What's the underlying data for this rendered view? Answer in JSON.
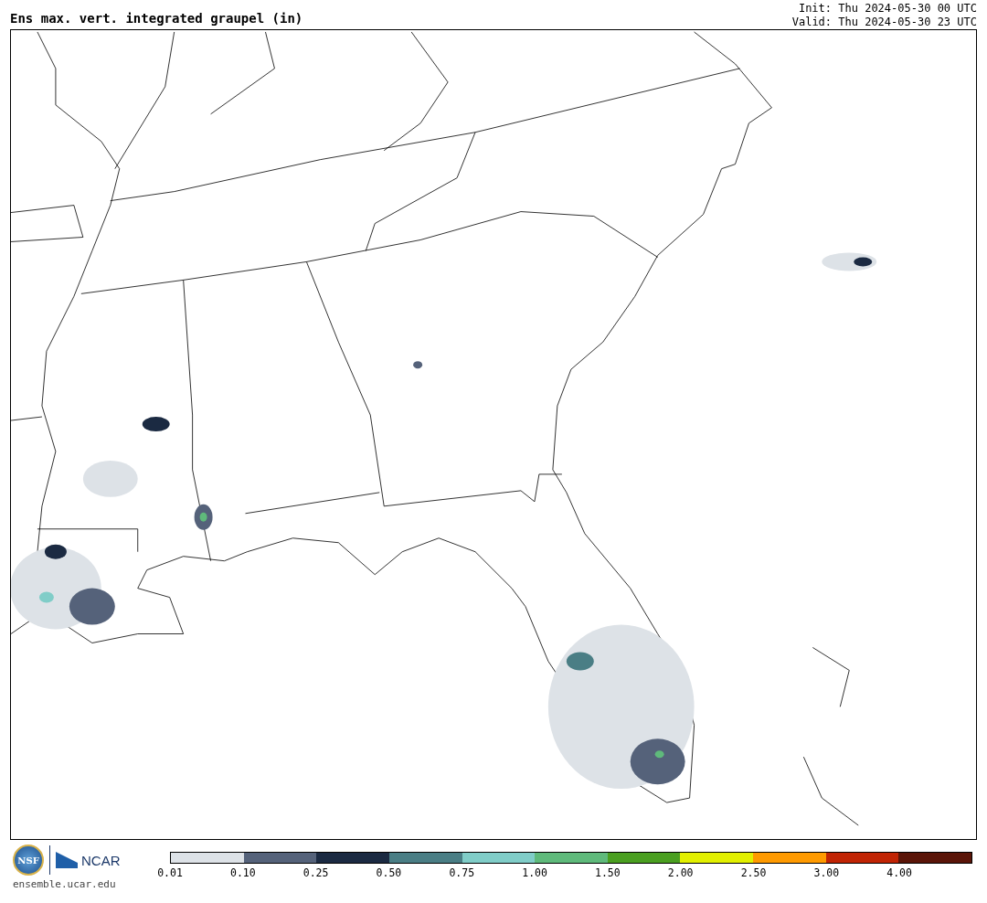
{
  "header": {
    "title": "Ens max. vert. integrated graupel (in)",
    "init": "Init: Thu 2024-05-30 00 UTC",
    "valid": "Valid: Thu 2024-05-30 23 UTC"
  },
  "logos": {
    "nsf": "NSF",
    "ncar": "NCAR",
    "url": "ensemble.ucar.edu"
  },
  "colorbar": [
    {
      "label": "0.01",
      "color": "#dde2e7"
    },
    {
      "label": "0.10",
      "color": "#55627a"
    },
    {
      "label": "0.25",
      "color": "#1b2a42"
    },
    {
      "label": "0.50",
      "color": "#4a7e85"
    },
    {
      "label": "0.75",
      "color": "#80cdc8"
    },
    {
      "label": "1.00",
      "color": "#5fba7b"
    },
    {
      "label": "1.50",
      "color": "#4a9f20"
    },
    {
      "label": "2.00",
      "color": "#e2f000"
    },
    {
      "label": "2.50",
      "color": "#ff9a00"
    },
    {
      "label": "3.00",
      "color": "#c12404"
    },
    {
      "label": "4.00",
      "color": "#5b1508"
    }
  ]
}
